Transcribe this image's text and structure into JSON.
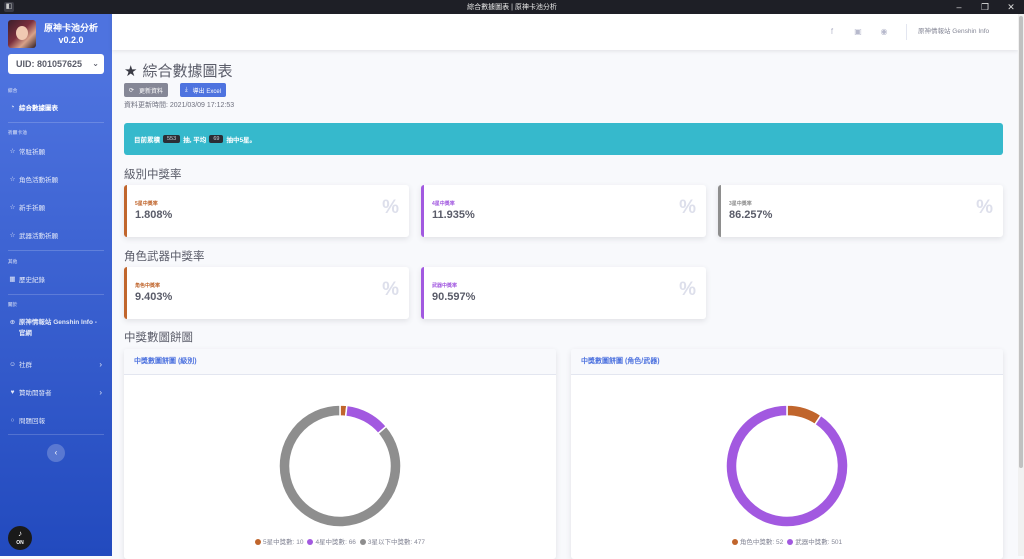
{
  "window": {
    "title": "綜合數據圖表 | 原神卡池分析",
    "controls": [
      "–",
      "❐",
      "✕"
    ]
  },
  "sidebar": {
    "brand": {
      "name": "原神卡池分析",
      "version": "v0.2.0"
    },
    "uid": "UID: 801057625",
    "sections": [
      {
        "heading": "綜合",
        "items": [
          {
            "label": "綜合數據圖表",
            "icon": "dashboard-icon",
            "active": true
          }
        ]
      },
      {
        "heading": "祈願卡池",
        "items": [
          {
            "label": "常駐祈願",
            "icon": "star-icon"
          },
          {
            "label": "角色活動祈願",
            "icon": "star-icon"
          },
          {
            "label": "新手祈願",
            "icon": "star-icon"
          },
          {
            "label": "武器活動祈願",
            "icon": "star-icon"
          }
        ]
      },
      {
        "heading": "其他",
        "items": [
          {
            "label": "歷史紀錄",
            "icon": "table-icon"
          }
        ]
      },
      {
        "heading": "關於",
        "items": [
          {
            "label": "原神情報站 Genshin Info - 官網",
            "icon": "globe-icon"
          },
          {
            "label": "社群",
            "icon": "community-icon",
            "arrow": true
          },
          {
            "label": "贊助開發者",
            "icon": "donate-icon",
            "arrow": true
          },
          {
            "label": "問題回報",
            "icon": "bug-icon"
          }
        ]
      }
    ],
    "toggle_icon": "‹",
    "music": {
      "note": "♪",
      "label": "ON"
    }
  },
  "topbar": {
    "social_icons": [
      "facebook-icon",
      "discord-icon",
      "github-icon"
    ],
    "link": "原神情報站 Genshin Info"
  },
  "main": {
    "title": "綜合數據圖表",
    "buttons": {
      "refresh": "更新資料",
      "export": "導出 Excel"
    },
    "updated": "資料更新時間: 2021/03/09 17:12:53",
    "alert": {
      "prefix": "目前累積",
      "total": "553",
      "mid": "抽, 平均",
      "avg": "69",
      "suffix": "抽中5星。"
    },
    "rarity_section": "級別中獎率",
    "rarity_cards": [
      {
        "label": "5星中獎率",
        "value": "1.808%",
        "color": "#c0652c"
      },
      {
        "label": "4星中獎率",
        "value": "11.935%",
        "color": "#a259e0"
      },
      {
        "label": "3星中獎率",
        "value": "86.257%",
        "color": "#8e8e8e"
      }
    ],
    "type_section": "角色武器中獎率",
    "type_cards": [
      {
        "label": "角色中獎率",
        "value": "9.403%",
        "color": "#c0652c"
      },
      {
        "label": "武器中獎率",
        "value": "90.597%",
        "color": "#a259e0"
      }
    ],
    "pie_section": "中獎數圖餅圖",
    "pct_symbol": "%"
  },
  "chart_data": [
    {
      "type": "pie",
      "title": "中獎數圖餅圖 (級別)",
      "categories": [
        "5星中獎數",
        "4星中獎數",
        "3星以下中獎數"
      ],
      "values": [
        10,
        66,
        477
      ],
      "colors": [
        "#c0652c",
        "#a259e0",
        "#8e8e8e"
      ],
      "legend_position": "bottom"
    },
    {
      "type": "pie",
      "title": "中獎數圖餅圖 (角色/武器)",
      "categories": [
        "角色中獎數",
        "武器中獎數"
      ],
      "values": [
        52,
        501
      ],
      "colors": [
        "#c0652c",
        "#a259e0"
      ],
      "legend_position": "bottom"
    }
  ]
}
